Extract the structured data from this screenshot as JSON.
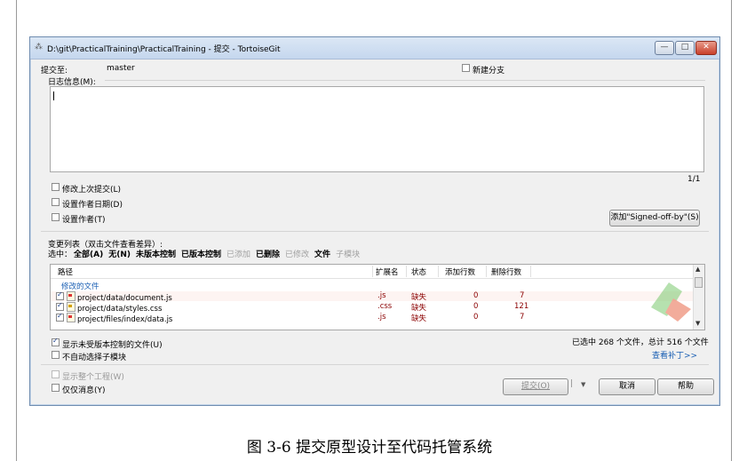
{
  "window": {
    "title": "D:\\git\\PracticalTraining\\PracticalTraining - 提交 - TortoiseGit",
    "title_icon": "tortoisegit-icon",
    "minimize": "—",
    "maximize": "□",
    "close": "✕"
  },
  "commit": {
    "commit_to_label": "提交至:",
    "branch": "master",
    "new_branch_label": "新建分支",
    "new_branch_checked": false,
    "log_label": "日志信息(M):",
    "log_value": "",
    "line_counter": "1/1"
  },
  "options": {
    "amend": {
      "label": "修改上次提交(L)",
      "checked": false
    },
    "set_author_date": {
      "label": "设置作者日期(D)",
      "checked": false
    },
    "set_author": {
      "label": "设置作者(T)",
      "checked": false
    }
  },
  "signed_off_button": "添加\"Signed-off-by\"(S)",
  "changes": {
    "title": "变更列表（双击文件查看差异）:",
    "select_label": "选中：",
    "filters": [
      {
        "label": "全部(A)",
        "bold": true,
        "dim": false
      },
      {
        "label": "无(N)",
        "bold": true,
        "dim": false
      },
      {
        "label": "未版本控制",
        "bold": true,
        "dim": false
      },
      {
        "label": "已版本控制",
        "bold": true,
        "dim": false
      },
      {
        "label": "已添加",
        "bold": false,
        "dim": true
      },
      {
        "label": "已删除",
        "bold": true,
        "dim": false
      },
      {
        "label": "已修改",
        "bold": false,
        "dim": true
      },
      {
        "label": "文件",
        "bold": true,
        "dim": false
      },
      {
        "label": "子模块",
        "bold": false,
        "dim": true
      }
    ],
    "columns": [
      "路径",
      "扩展名",
      "状态",
      "添加行数",
      "删除行数"
    ],
    "group": "修改的文件",
    "rows": [
      {
        "path": "project/data/document.js",
        "ext": ".js",
        "status": "缺失",
        "added": "0",
        "deleted": "7",
        "checked": true
      },
      {
        "path": "project/data/styles.css",
        "ext": ".css",
        "status": "缺失",
        "added": "0",
        "deleted": "121",
        "checked": true
      },
      {
        "path": "project/files/index/data.js",
        "ext": ".js",
        "status": "缺失",
        "added": "0",
        "deleted": "7",
        "checked": true
      }
    ],
    "summary": "已选中 268 个文件，总计 516 个文件",
    "view_patch": "查看补丁>>"
  },
  "bottom_options": {
    "show_unversioned": {
      "label": "显示未受版本控制的文件(U)",
      "checked": true
    },
    "no_auto_submodules": {
      "label": "不自动选择子模块",
      "checked": false
    },
    "show_whole_project": {
      "label": "显示整个工程(W)",
      "checked": false,
      "disabled": true
    },
    "message_only": {
      "label": "仅仅消息(Y)",
      "checked": false
    }
  },
  "buttons": {
    "commit": "提交(O)",
    "dropdown": "▼",
    "cancel": "取消",
    "help": "帮助"
  },
  "caption": "图 3-6  提交原型设计至代码托管系统"
}
